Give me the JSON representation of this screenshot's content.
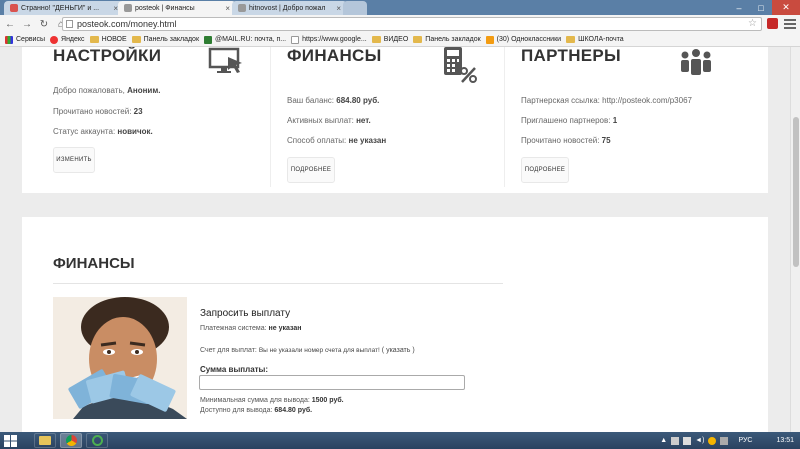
{
  "browser": {
    "tabs": [
      {
        "title": "Странно! \"ДЕНЬГИ\" и ...",
        "favicon_color": "#d9534f",
        "active": false
      },
      {
        "title": "posteok | Финансы",
        "favicon_color": "#888888",
        "active": true
      },
      {
        "title": "hitnovost | Добро пожал",
        "favicon_color": "#888888",
        "active": false
      }
    ],
    "url": "posteok.com/money.html",
    "bookmarks": [
      {
        "label": "Сервисы",
        "icon": "apps-grid-icon"
      },
      {
        "label": "Яндекс",
        "icon": "yandex-icon"
      },
      {
        "label": "НОВОЕ",
        "icon": "folder-icon"
      },
      {
        "label": "Панель закладок",
        "icon": "folder-icon"
      },
      {
        "label": "@MAIL.RU: почта, п...",
        "icon": "mailru-icon"
      },
      {
        "label": "https://www.google...",
        "icon": "page-icon"
      },
      {
        "label": "ВИДЕО",
        "icon": "folder-icon"
      },
      {
        "label": "Панель закладок",
        "icon": "folder-icon"
      },
      {
        "label": "(30) Одноклассники",
        "icon": "odnoklassniki-icon"
      },
      {
        "label": "ШКОЛА-почта",
        "icon": "folder-icon"
      }
    ]
  },
  "settings": {
    "title": "НАСТРОЙКИ",
    "welcome_label": "Добро пожаловать,",
    "welcome_value": "Аноним.",
    "news_label": "Прочитано новостей:",
    "news_value": "23",
    "status_label": "Статус аккаунта:",
    "status_value": "новичок.",
    "button": "ИЗМЕНИТЬ",
    "icon": "monitor-cursor-icon"
  },
  "finances": {
    "title": "ФИНАНСЫ",
    "balance_label": "Ваш баланс:",
    "balance_value": "684.80 руб.",
    "active_payouts_label": "Активных выплат:",
    "active_payouts_value": "нет.",
    "pay_method_label": "Способ оплаты:",
    "pay_method_value": "не указан",
    "button": "ПОДРОБНЕЕ",
    "icon": "calculator-percent-icon"
  },
  "partners": {
    "title": "ПАРТНЕРЫ",
    "ref_label": "Партнерская ссылка:",
    "ref_value": "http://posteok.com/p3067",
    "invited_label": "Приглашено партнеров:",
    "invited_value": "1",
    "news_label": "Прочитано новостей:",
    "news_value": "75",
    "button": "ПОДРОБНЕЕ",
    "icon": "people-group-icon"
  },
  "payout": {
    "section_title": "ФИНАНСЫ",
    "title": "Запросить выплату",
    "system_label": "Платежная система:",
    "system_value": "не указан",
    "account_label": "Счет для выплат:",
    "account_value": "Вы не указали номер счета для выплат!",
    "account_link": "( указать )",
    "amount_label": "Сумма выплаты:",
    "amount_value": "",
    "min_label": "Минимальная сумма для вывода:",
    "min_value": "1500 руб.",
    "available_label": "Доступно для вывода:",
    "available_value": "684.80 руб."
  },
  "taskbar": {
    "lang": "РУС",
    "time": "13:51"
  }
}
